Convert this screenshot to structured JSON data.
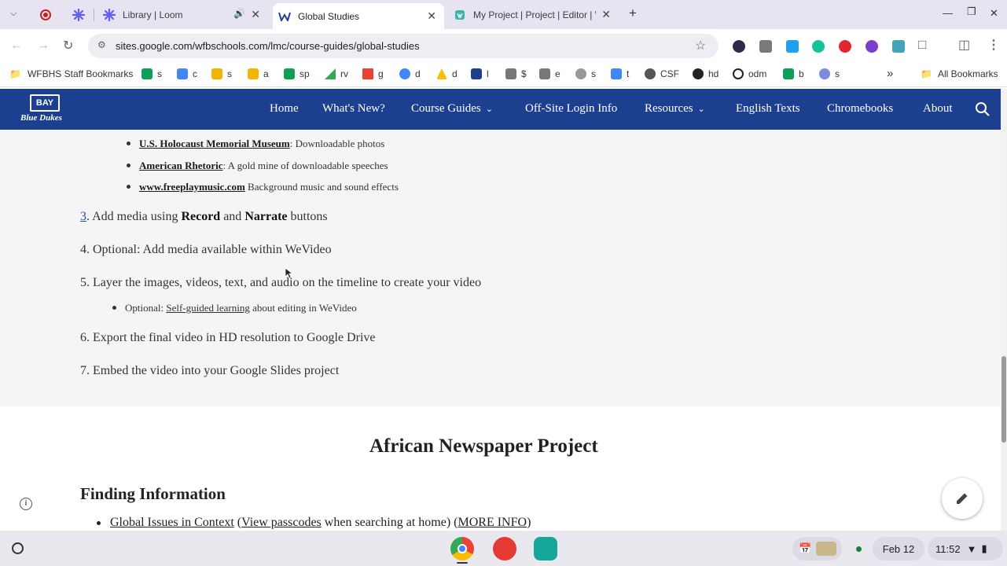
{
  "browser": {
    "tabs": [
      {
        "title": "",
        "icon": "record-icon"
      },
      {
        "title": "",
        "icon": "loom-icon"
      },
      {
        "title": "Library | Loom",
        "icon": "loom-icon"
      },
      {
        "title": "Global Studies",
        "icon": "site-icon",
        "active": true
      },
      {
        "title": "My Project | Project | Editor | W",
        "icon": "wevideo-icon"
      }
    ],
    "url": "sites.google.com/wfbschools.com/lmc/course-guides/global-studies",
    "bookmarks": [
      {
        "label": "WFBHS Staff Bookmarks",
        "color": "#5f6368"
      },
      {
        "label": "s",
        "color": "#0f9d58"
      },
      {
        "label": "c",
        "color": "#4285f4"
      },
      {
        "label": "s",
        "color": "#f4b400"
      },
      {
        "label": "a",
        "color": "#f4b400"
      },
      {
        "label": "sp",
        "color": "#0f9d58"
      },
      {
        "label": "rv",
        "color": "#34a853"
      },
      {
        "label": "g",
        "color": "#ea4335"
      },
      {
        "label": "d",
        "color": "#4285f4"
      },
      {
        "label": "d",
        "color": "#fbbc04"
      },
      {
        "label": "l",
        "color": "#1d3f8f"
      },
      {
        "label": "$",
        "color": "#444444"
      },
      {
        "label": "e",
        "color": "#444444"
      },
      {
        "label": "s",
        "color": "#5f6368"
      },
      {
        "label": "t",
        "color": "#4285f4"
      },
      {
        "label": "CSF",
        "color": "#444444"
      },
      {
        "label": "hd",
        "color": "#222222"
      },
      {
        "label": "odm",
        "color": "#222222"
      },
      {
        "label": "b",
        "color": "#0f9d58"
      },
      {
        "label": "s",
        "color": "#7b8cde"
      }
    ],
    "all_bookmarks": "All Bookmarks"
  },
  "site": {
    "logo": {
      "top": "BAY",
      "bottom": "Blue Dukes"
    },
    "nav": [
      "Home",
      "What's New?",
      "Course Guides",
      "Off-Site Login Info",
      "Resources",
      "English Texts",
      "Chromebooks",
      "About"
    ]
  },
  "content": {
    "sub_items": [
      {
        "link": "U.S. Holocaust Memorial Museum",
        "text": ": Downloadable photos"
      },
      {
        "link": "American Rhetoric",
        "text": ": A gold mine of downloadable speeches"
      },
      {
        "link": "www.freeplaymusic.com",
        "text": " Background music and sound effects"
      }
    ],
    "step3": {
      "num": "3",
      "a": ". Add media using ",
      "b1": "Record",
      "c": " and ",
      "b2": "Narrate",
      "d": " buttons"
    },
    "step4": "4. Optional: Add media available within WeVideo",
    "step5": "5. Layer the images, videos, text, and audio on the timeline to create your video",
    "step5_sub": {
      "prefix": "Optional: ",
      "link": "Self-guided learning",
      "suffix": " about editing in WeVideo"
    },
    "step6": "6. Export the final video in HD resolution to Google Drive",
    "step7": "7. Embed the video into your Google Slides project",
    "section_title": "African Newspaper Project",
    "subsection_title": "Finding Information",
    "last_item": {
      "a": "Global Issues in Context",
      "b": " (",
      "c": "View passcodes",
      "d": " when searching at home) (",
      "e": "MORE INFO",
      "f": ")"
    }
  },
  "shelf": {
    "date": "Feb 12",
    "time": "11:52"
  }
}
